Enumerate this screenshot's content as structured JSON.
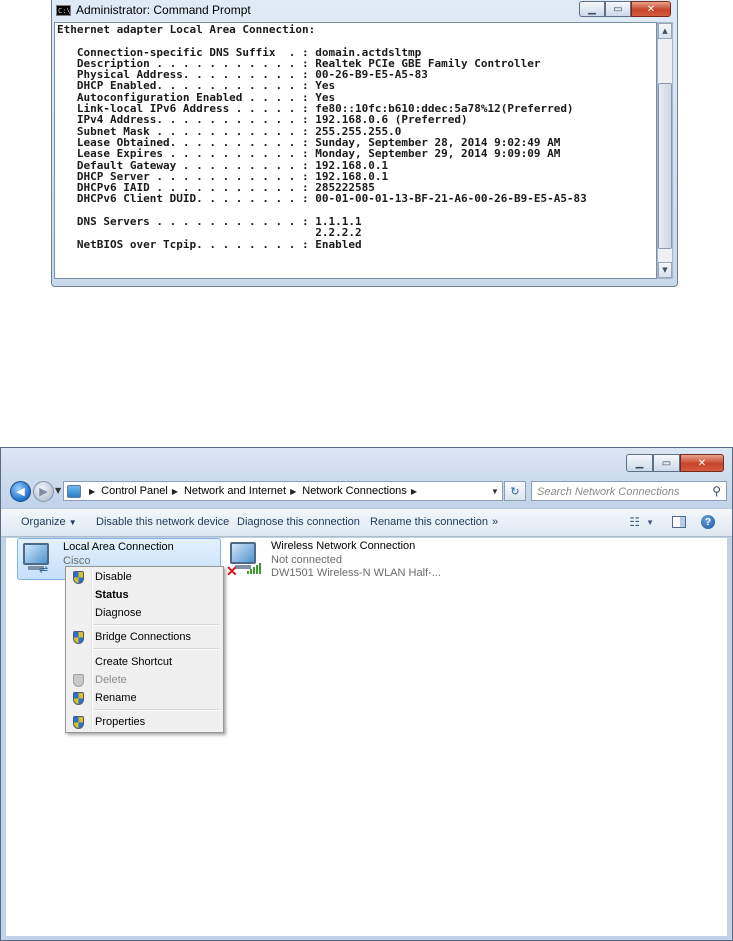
{
  "cmd": {
    "title": "Administrator: Command Prompt",
    "icon_text": "C:\\",
    "lines": [
      "Ethernet adapter Local Area Connection:",
      "",
      "   Connection-specific DNS Suffix  . : domain.actdsltmp",
      "   Description . . . . . . . . . . . : Realtek PCIe GBE Family Controller",
      "   Physical Address. . . . . . . . . : 00-26-B9-E5-A5-83",
      "   DHCP Enabled. . . . . . . . . . . : Yes",
      "   Autoconfiguration Enabled . . . . : Yes",
      "   Link-local IPv6 Address . . . . . : fe80::10fc:b610:ddec:5a78%12(Preferred)",
      "   IPv4 Address. . . . . . . . . . . : 192.168.0.6 (Preferred)",
      "   Subnet Mask . . . . . . . . . . . : 255.255.255.0",
      "   Lease Obtained. . . . . . . . . . : Sunday, September 28, 2014 9:02:49 AM",
      "   Lease Expires . . . . . . . . . . : Monday, September 29, 2014 9:09:09 AM",
      "   Default Gateway . . . . . . . . . : 192.168.0.1",
      "   DHCP Server . . . . . . . . . . . : 192.168.0.1",
      "   DHCPv6 IAID . . . . . . . . . . . : 285222585",
      "   DHCPv6 Client DUID. . . . . . . . : 00-01-00-01-13-BF-21-A6-00-26-B9-E5-A5-83",
      "",
      "   DNS Servers . . . . . . . . . . . : 1.1.1.1",
      "                                       2.2.2.2",
      "   NetBIOS over Tcpip. . . . . . . . : Enabled"
    ]
  },
  "explorer": {
    "breadcrumb": [
      "Control Panel",
      "Network and Internet",
      "Network Connections"
    ],
    "search_placeholder": "Search Network Connections",
    "toolbar": {
      "organize": "Organize",
      "disable": "Disable this network device",
      "diagnose": "Diagnose this connection",
      "rename": "Rename this connection",
      "more": "»"
    },
    "connections": [
      {
        "name": "Local Area Connection",
        "status": "Cisco",
        "device": ""
      },
      {
        "name": "Wireless Network Connection",
        "status": "Not connected",
        "device": "DW1501 Wireless-N WLAN Half-..."
      }
    ]
  },
  "context_menu": {
    "items": [
      {
        "label": "Disable",
        "icon": "shield-icon",
        "style": "normal"
      },
      {
        "label": "Status",
        "icon": "",
        "style": "bold"
      },
      {
        "label": "Diagnose",
        "icon": "",
        "style": "normal"
      },
      {
        "label": "Bridge Connections",
        "icon": "shield-icon",
        "style": "normal"
      },
      {
        "label": "Create Shortcut",
        "icon": "",
        "style": "normal"
      },
      {
        "label": "Delete",
        "icon": "shield-icon",
        "style": "disabled"
      },
      {
        "label": "Rename",
        "icon": "shield-icon",
        "style": "normal"
      },
      {
        "label": "Properties",
        "icon": "shield-icon",
        "style": "normal"
      }
    ]
  }
}
